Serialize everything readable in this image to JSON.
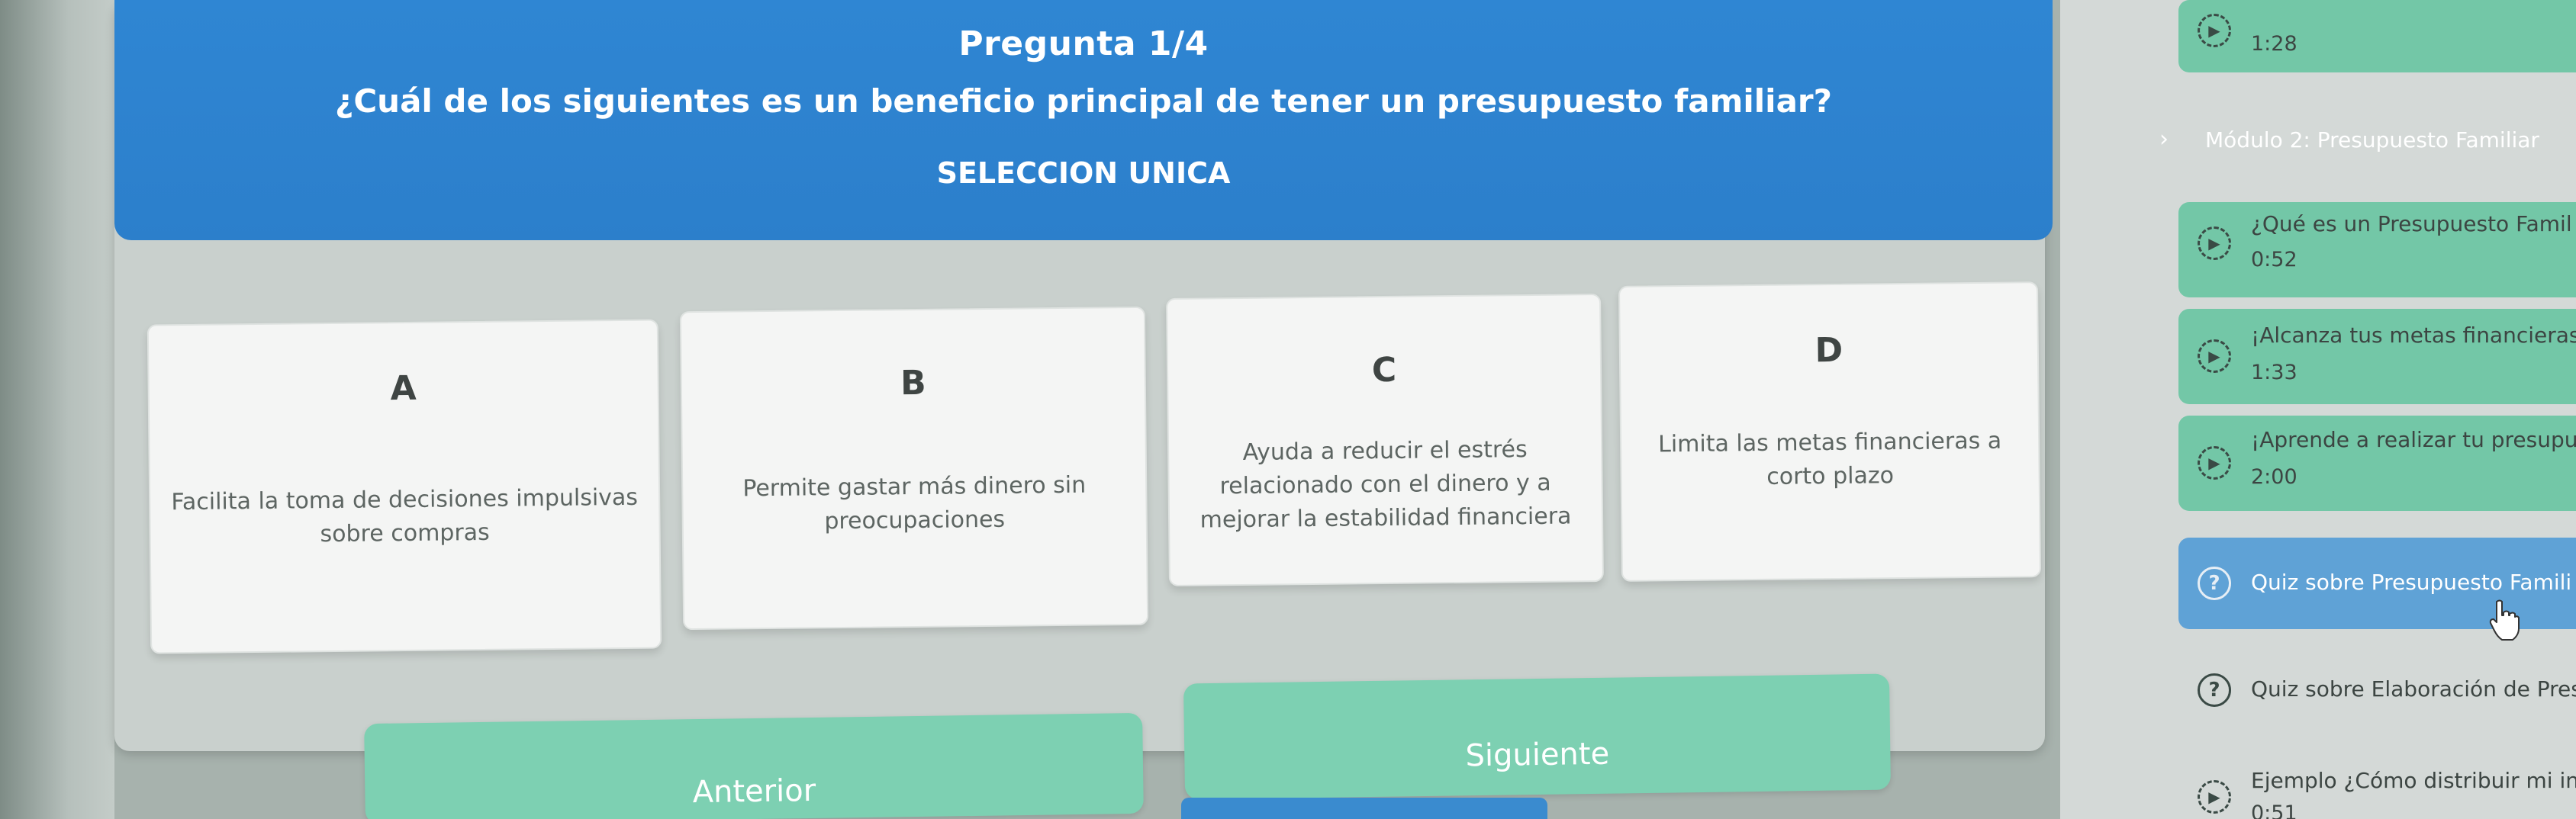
{
  "header": {
    "title": "Pregunta 1/4",
    "question": "¿Cuál de los siguientes es un beneficio principal de tener un presupuesto familiar?",
    "mode": "SELECCION UNICA"
  },
  "options": [
    {
      "letter": "A",
      "text": "Facilita la toma de decisiones impulsivas sobre compras"
    },
    {
      "letter": "B",
      "text": "Permite gastar más dinero sin preocupaciones"
    },
    {
      "letter": "C",
      "text": "Ayuda a reducir el estrés relacionado con el dinero y a mejorar la estabilidad financiera"
    },
    {
      "letter": "D",
      "text": "Limita las metas financieras a corto plazo"
    }
  ],
  "nav": {
    "prev_label": "Anterior",
    "next_label": "Siguiente"
  },
  "sidebar": {
    "top_time": "1:28",
    "module_label": "Módulo 2: Presupuesto Familiar",
    "items": [
      {
        "label": "¿Qué es un Presupuesto Famil",
        "time": "0:52",
        "icon": "play-icon"
      },
      {
        "label": "¡Alcanza tus metas financieras",
        "time": "1:33",
        "icon": "play-icon"
      },
      {
        "label": "¡Aprende a realizar tu presupu",
        "time": "2:00",
        "icon": "play-icon"
      },
      {
        "label": "Quiz sobre Presupuesto Famili",
        "icon": "quiz-icon"
      },
      {
        "label": "Quiz sobre Elaboración de Pres",
        "icon": "quiz-icon"
      },
      {
        "label": "Ejemplo ¿Cómo distribuir mi in",
        "time": "0:51",
        "icon": "play-icon"
      }
    ]
  },
  "colors": {
    "header_blue": "#2f86d3",
    "sidebar_green": "#73c7a7",
    "sidebar_active_blue": "#5fa2d6",
    "button_green": "#7dd0b2"
  }
}
